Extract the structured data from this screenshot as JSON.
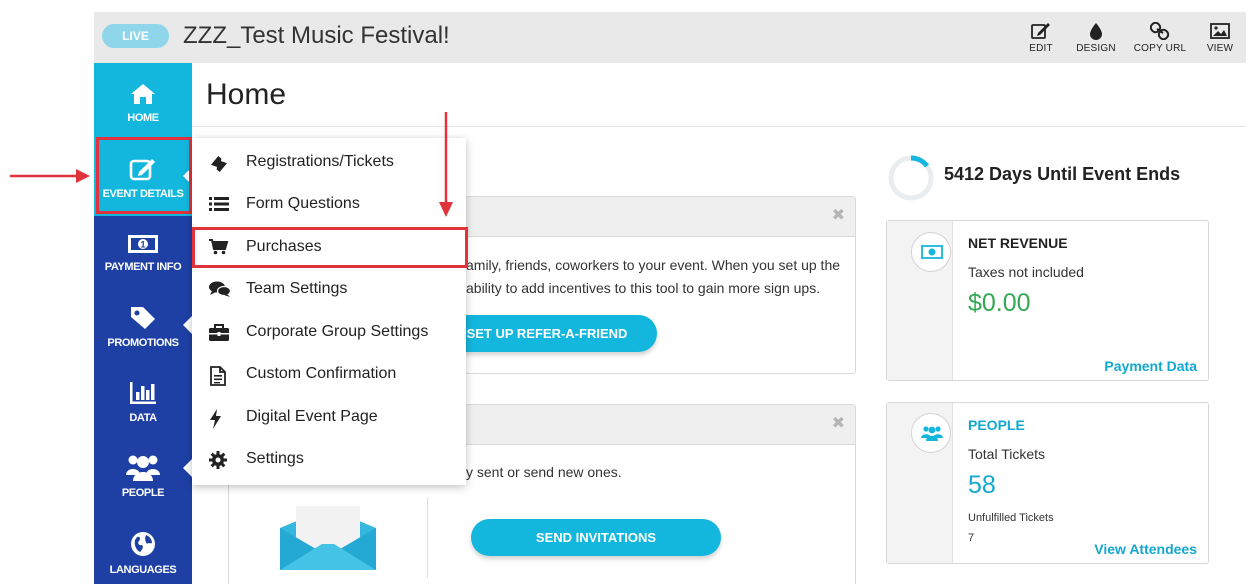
{
  "header": {
    "live_badge": "LIVE",
    "event_title": "ZZZ_Test Music Festival!",
    "tools": [
      {
        "label": "EDIT",
        "icon": "edit-icon"
      },
      {
        "label": "DESIGN",
        "icon": "droplet-icon"
      },
      {
        "label": "COPY URL",
        "icon": "link-icon"
      },
      {
        "label": "VIEW",
        "icon": "image-icon"
      }
    ]
  },
  "sidebar": {
    "items": [
      {
        "label": "HOME",
        "icon": "home-icon"
      },
      {
        "label": "EVENT DETAILS",
        "icon": "edit-icon"
      },
      {
        "label": "PAYMENT INFO",
        "icon": "money-icon"
      },
      {
        "label": "PROMOTIONS",
        "icon": "tag-icon"
      },
      {
        "label": "DATA",
        "icon": "bar-chart-icon"
      },
      {
        "label": "PEOPLE",
        "icon": "people-icon"
      },
      {
        "label": "LANGUAGES",
        "icon": "globe-icon"
      }
    ]
  },
  "page": {
    "title": "Home"
  },
  "dropdown": {
    "items": [
      {
        "label": "Registrations/Tickets",
        "icon": "ticket-icon"
      },
      {
        "label": "Form Questions",
        "icon": "list-icon"
      },
      {
        "label": "Purchases",
        "icon": "cart-icon"
      },
      {
        "label": "Team Settings",
        "icon": "comments-icon"
      },
      {
        "label": "Corporate Group Settings",
        "icon": "briefcase-icon"
      },
      {
        "label": "Custom Confirmation",
        "icon": "document-icon"
      },
      {
        "label": "Digital Event Page",
        "icon": "bolt-icon"
      },
      {
        "label": "Settings",
        "icon": "gear-icon"
      }
    ]
  },
  "refer_card": {
    "line1": "amily, friends, coworkers to your event. When you set up the",
    "line2": "ability to add incentives to this tool to gain more sign ups.",
    "button": "SET UP REFER-A-FRIEND"
  },
  "invite_card": {
    "text": "y sent or send new ones.",
    "button": "SEND INVITATIONS"
  },
  "countdown": {
    "text": "5412 Days Until Event Ends"
  },
  "revenue": {
    "title": "NET REVENUE",
    "subtitle": "Taxes not included",
    "amount": "$0.00",
    "link": "Payment Data"
  },
  "people": {
    "title": "PEOPLE",
    "subtitle": "Total Tickets",
    "total": "58",
    "unfulfilled_label": "Unfulfilled Tickets",
    "unfulfilled_value": "7",
    "link": "View Attendees"
  },
  "colors": {
    "accent": "#13b7de",
    "sidebar": "#1e40a5",
    "annotation_red": "#e0333c",
    "revenue_green": "#34a853"
  }
}
